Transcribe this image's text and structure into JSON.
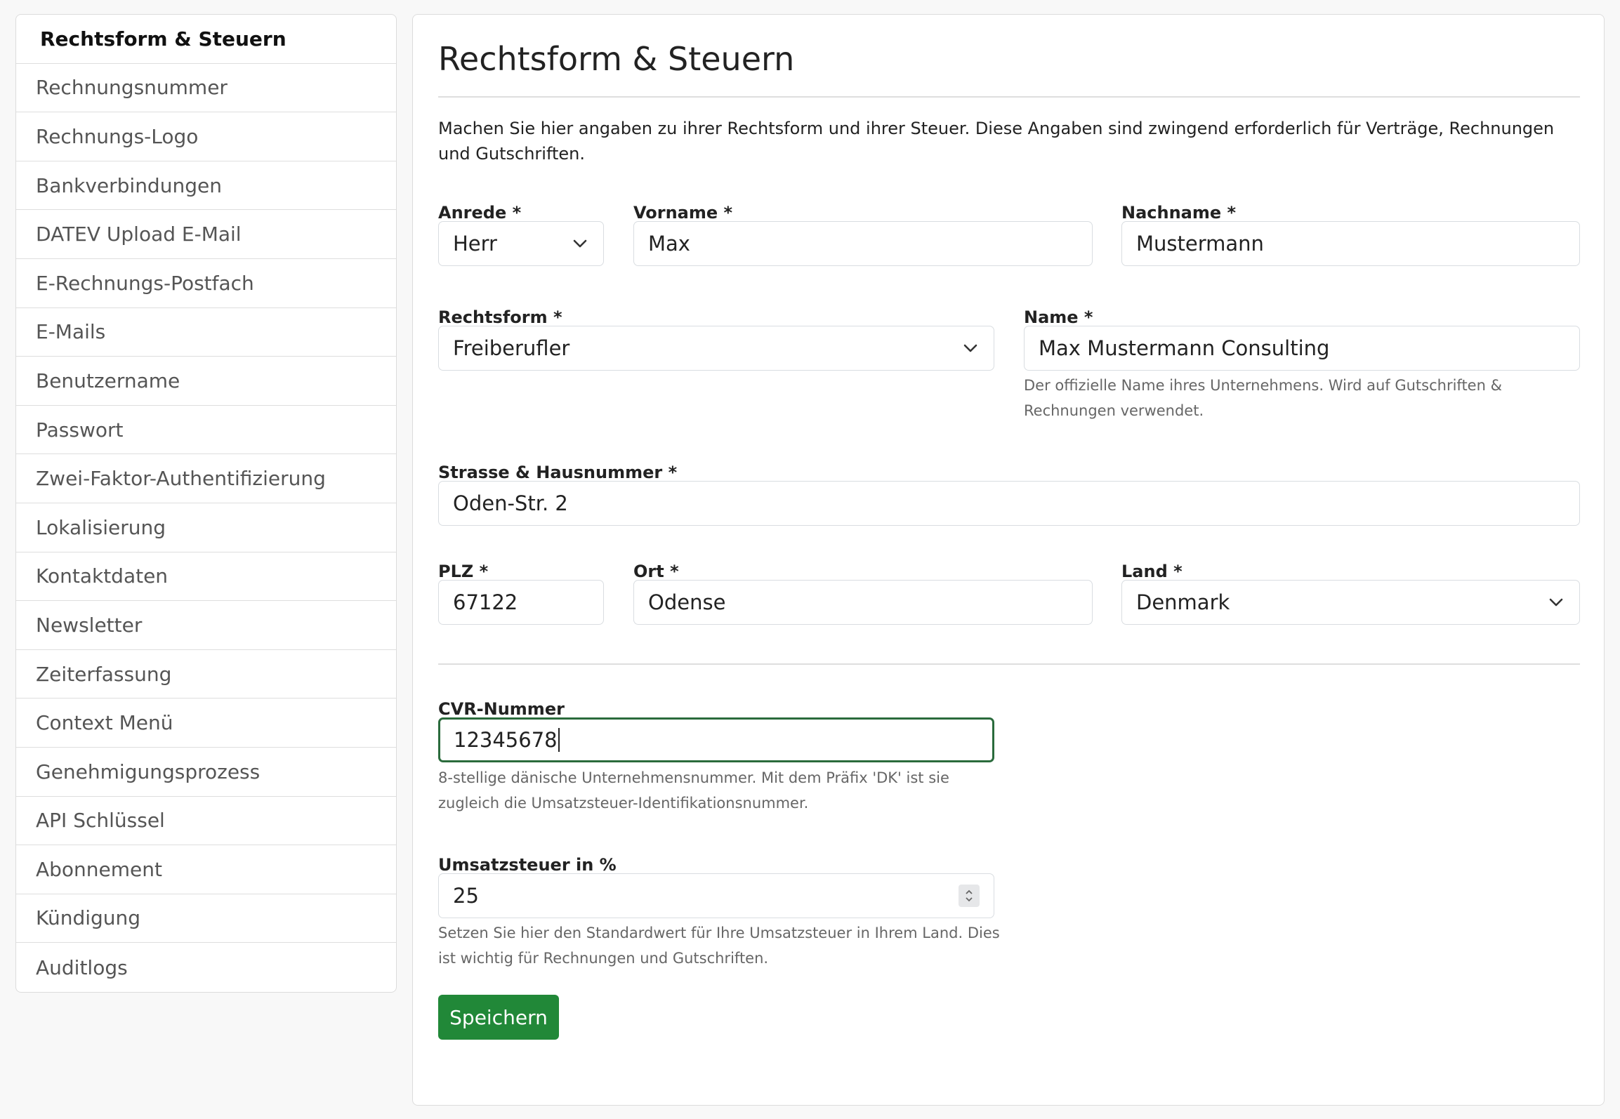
{
  "sidebar": {
    "items": [
      {
        "label": "Rechtsform & Steuern"
      },
      {
        "label": "Rechnungsnummer"
      },
      {
        "label": "Rechnungs-Logo"
      },
      {
        "label": "Bankverbindungen"
      },
      {
        "label": "DATEV Upload E-Mail"
      },
      {
        "label": "E-Rechnungs-Postfach"
      },
      {
        "label": "E-Mails"
      },
      {
        "label": "Benutzername"
      },
      {
        "label": "Passwort"
      },
      {
        "label": "Zwei-Faktor-Authentifizierung"
      },
      {
        "label": "Lokalisierung"
      },
      {
        "label": "Kontaktdaten"
      },
      {
        "label": "Newsletter"
      },
      {
        "label": "Zeiterfassung"
      },
      {
        "label": "Context Menü"
      },
      {
        "label": "Genehmigungsprozess"
      },
      {
        "label": "API Schlüssel"
      },
      {
        "label": "Abonnement"
      },
      {
        "label": "Kündigung"
      },
      {
        "label": "Auditlogs"
      }
    ]
  },
  "main": {
    "title": "Rechtsform & Steuern",
    "intro": "Machen Sie hier angaben zu ihrer Rechtsform und ihrer Steuer. Diese Angaben sind zwingend erforderlich für Verträge, Rechnungen und Gutschriften.",
    "fields": {
      "anrede": {
        "label": "Anrede *",
        "value": "Herr"
      },
      "vorname": {
        "label": "Vorname *",
        "value": "Max"
      },
      "nachname": {
        "label": "Nachname *",
        "value": "Mustermann"
      },
      "rechtsform": {
        "label": "Rechtsform *",
        "value": "Freiberufler"
      },
      "name": {
        "label": "Name *",
        "value": "Max Mustermann Consulting",
        "help": "Der offizielle Name ihres Unternehmens. Wird auf Gutschriften & Rechnungen verwendet."
      },
      "strasse": {
        "label": "Strasse & Hausnummer *",
        "value": "Oden-Str. 2"
      },
      "plz": {
        "label": "PLZ *",
        "value": "67122"
      },
      "ort": {
        "label": "Ort *",
        "value": "Odense"
      },
      "land": {
        "label": "Land *",
        "value": "Denmark"
      },
      "cvr": {
        "label": "CVR-Nummer",
        "value": "12345678",
        "help": "8-stellige dänische Unternehmensnummer. Mit dem Präfix 'DK' ist sie zugleich die Umsatzsteuer-Identifikationsnummer."
      },
      "ust": {
        "label": "Umsatzsteuer in %",
        "value": "25",
        "help": "Setzen Sie hier den Standardwert für Ihre Umsatzsteuer in Ihrem Land. Dies ist wichtig für Rechnungen und Gutschriften."
      }
    },
    "save_label": "Speichern"
  },
  "colors": {
    "primary_button": "#218838",
    "focus_border": "#2a6b3c"
  },
  "icons": {
    "select_arrow": "chevron-down-icon",
    "number_spinner": "spinner-arrows-icon"
  }
}
